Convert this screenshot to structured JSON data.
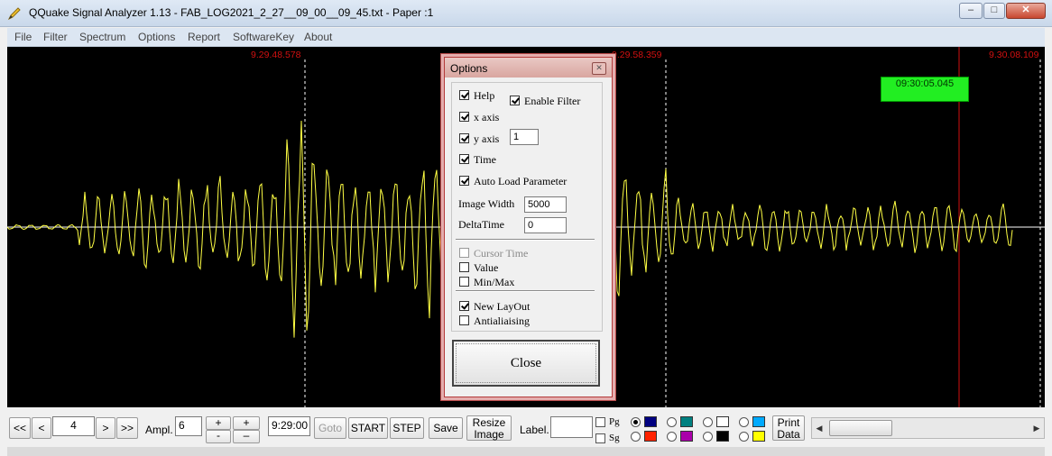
{
  "window": {
    "title": "QQuake Signal Analyzer 1.13 - FAB_LOG2021_2_27__09_00__09_45.txt - Paper :1",
    "minimize_label": "–",
    "maximize_label": "□",
    "close_label": "✕"
  },
  "menu": [
    {
      "label": "File"
    },
    {
      "label": "Filter"
    },
    {
      "label": "Spectrum"
    },
    {
      "label": "Options"
    },
    {
      "label": "Report"
    },
    {
      "label": "SoftwareKey"
    },
    {
      "label": "About"
    }
  ],
  "plot": {
    "time_labels": [
      "9.29.48.578",
      "9.29.58.359",
      "9.30.08.109"
    ],
    "cursor_time": "09:30:05.045",
    "colors": {
      "background": "#000000",
      "signal": "#ffff44",
      "axis": "#ffffff",
      "cursor": "#d21010",
      "time_label": "#d21010"
    }
  },
  "dialog": {
    "title": "Options",
    "close_icon": "✕",
    "help": {
      "label": "Help",
      "checked": true
    },
    "enable_filter": {
      "label": "Enable Filter",
      "checked": true
    },
    "x_axis": {
      "label": "x axis",
      "checked": true
    },
    "y_axis": {
      "label": "y axis",
      "checked": true,
      "value": "1"
    },
    "time": {
      "label": "Time",
      "checked": true
    },
    "auto_load": {
      "label": "Auto Load Parameter",
      "checked": true
    },
    "image_width": {
      "label": "Image Width",
      "value": "5000"
    },
    "delta_time": {
      "label": "DeltaTime",
      "value": "0"
    },
    "cursor_time": {
      "label": "Cursor Time",
      "checked": false,
      "disabled": true
    },
    "value_opt": {
      "label": "Value",
      "checked": false
    },
    "minmax": {
      "label": "Min/Max",
      "checked": false
    },
    "new_layout": {
      "label": "New LayOut",
      "checked": true
    },
    "antialias": {
      "label": "Antialiaising",
      "checked": false
    },
    "close_label": "Close"
  },
  "toolbar": {
    "first": "<<",
    "prev": "<",
    "page": "4",
    "next": ">",
    "last": ">>",
    "ampl_label": "Ampl.",
    "ampl_value": "6",
    "plus": "+",
    "minus": "-",
    "plus2": "+",
    "minus2": "–",
    "time_value": "9:29:00",
    "goto": "Goto",
    "start": "START",
    "step": "STEP",
    "save": "Save",
    "resize_line1": "Resize",
    "resize_line2": "Image",
    "label_label": "Label.",
    "label_value": "",
    "pg": "Pg",
    "sg": "Sg",
    "print_line1": "Print",
    "print_line2": "Data",
    "colors_top": [
      "#000080",
      "#008080",
      "#ffffff",
      "#00aaff"
    ],
    "colors_bottom": [
      "#ff2200",
      "#aa00aa",
      "#000000",
      "#ffff00"
    ]
  }
}
